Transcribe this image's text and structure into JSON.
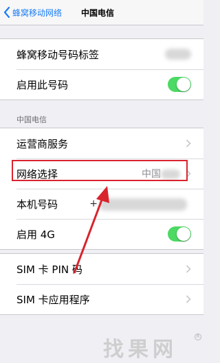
{
  "nav": {
    "back_label": "蜂窝移动网络",
    "title": "中国电信"
  },
  "group1": {
    "items": [
      {
        "label": "蜂窝移动号码标签"
      },
      {
        "label": "启用此号码",
        "toggle_on": true
      }
    ]
  },
  "section2": {
    "header": "中国电信",
    "items": [
      {
        "label": "运营商服务"
      },
      {
        "label": "网络选择",
        "value": "中国"
      },
      {
        "label": "本机号码",
        "value": "+"
      },
      {
        "label": "启用 4G",
        "toggle_on": true
      }
    ]
  },
  "group3": {
    "items": [
      {
        "label": "SIM 卡 PIN 码"
      },
      {
        "label": "SIM 卡应用程序"
      }
    ]
  },
  "watermark": {
    "text": "找果网",
    "badge": "R"
  },
  "colors": {
    "accent": "#1a7cf5",
    "toggle_on": "#4cd964",
    "highlight": "#d9232d"
  }
}
